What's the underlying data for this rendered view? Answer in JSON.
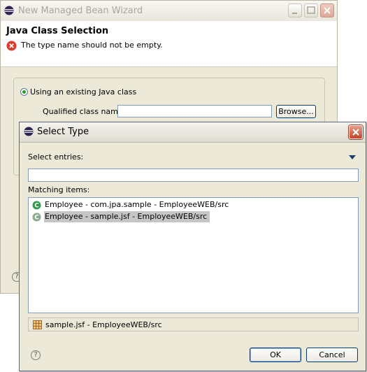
{
  "wizard": {
    "title": "New Managed Bean Wizard",
    "header_title": "Java Class Selection",
    "error_message": "The type name should not be empty.",
    "radio_existing_label": "Using an existing Java class",
    "qualified_label": "Qualified class name:",
    "qualified_value": "",
    "browse_label": "Browse..."
  },
  "dialog": {
    "title": "Select Type",
    "select_entries_label": "Select entries:",
    "filter_value": "",
    "matching_label": "Matching items:",
    "items": [
      {
        "label": "Employee - com.jpa.sample - EmployeeWEB/src",
        "selected": false
      },
      {
        "label": "Employee - sample.jsf - EmployeeWEB/src",
        "selected": true
      }
    ],
    "status_text": "sample.jsf - EmployeeWEB/src",
    "ok_label": "OK",
    "cancel_label": "Cancel"
  },
  "icons": {
    "app": "eclipse-icon",
    "error": "error-icon",
    "class": "class-icon",
    "package": "package-icon",
    "help": "help-icon"
  },
  "colors": {
    "selection": "#c6c6c6",
    "class_icon": "#2e9a4a",
    "error_icon": "#d93b2b"
  }
}
